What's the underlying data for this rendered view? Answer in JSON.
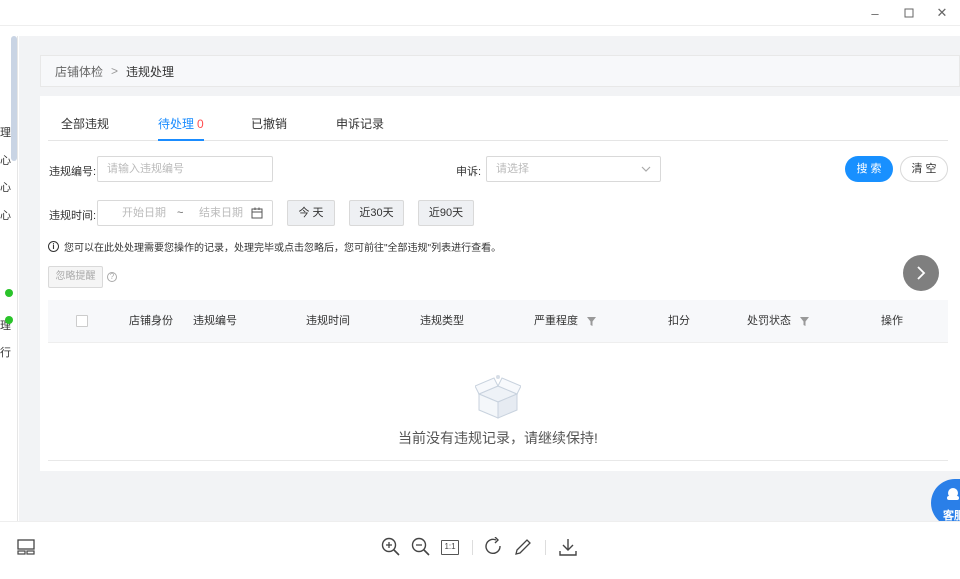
{
  "window_controls": {
    "minimize": "–",
    "maximize": "□",
    "close": "✕"
  },
  "left_strip": {
    "fragments": [
      "理",
      "心",
      "心",
      "心",
      "理",
      "行"
    ]
  },
  "breadcrumb": {
    "root": "店铺体检",
    "separator": ">",
    "current": "违规处理"
  },
  "tabs": [
    {
      "label": "全部违规"
    },
    {
      "label": "待处理",
      "count": "0"
    },
    {
      "label": "已撤销"
    },
    {
      "label": "申诉记录"
    }
  ],
  "filters": {
    "violation_no_label": "违规编号:",
    "violation_no_placeholder": "请输入违规编号",
    "appeal_label": "申诉:",
    "appeal_placeholder": "请选择",
    "time_label": "违规时间:",
    "start_placeholder": "开始日期",
    "range_sep": "~",
    "end_placeholder": "结束日期",
    "search_btn": "搜 索",
    "clear_btn": "清 空",
    "quick_today": "今 天",
    "quick_30": "近30天",
    "quick_90": "近90天"
  },
  "notice": "您可以在此处处理需要您操作的记录，处理完毕或点击忽略后，您可前往\"全部违规\"列表进行查看。",
  "ignore_btn": "忽略提醒",
  "help_mark": "?",
  "table": {
    "columns": [
      "店铺身份",
      "违规编号",
      "违规时间",
      "违规类型",
      "严重程度",
      "扣分",
      "处罚状态",
      "操作"
    ],
    "empty_text": "当前没有违规记录，请继续保持!"
  },
  "customer_service": {
    "label": "客服"
  },
  "viewer_toolbar": {
    "actual_size": "1:1"
  },
  "colors": {
    "accent": "#1890ff",
    "count_red": "#ff4d4f",
    "status_green": "#2ac32a",
    "cs_blue": "#2a7fe8"
  }
}
